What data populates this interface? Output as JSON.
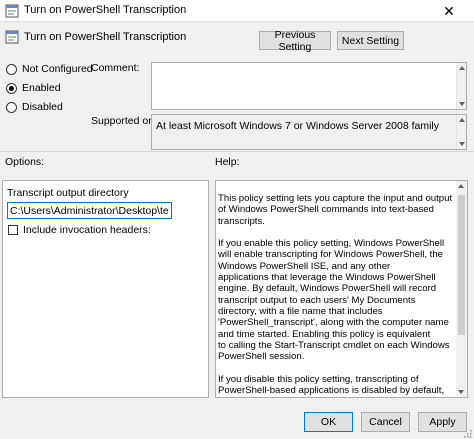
{
  "window": {
    "title": "Turn on PowerShell Transcription",
    "close_symbol": "✕"
  },
  "header": {
    "title": "Turn on PowerShell Transcription",
    "prev_label": "Previous Setting",
    "next_label": "Next Setting"
  },
  "state": {
    "options": [
      "Not Configured",
      "Enabled",
      "Disabled"
    ],
    "selected": "Enabled"
  },
  "comment": {
    "label": "Comment:",
    "value": ""
  },
  "supported": {
    "label": "Supported on:",
    "value": "At least Microsoft Windows 7 or Windows Server 2008 family"
  },
  "options_panel": {
    "label": "Options:",
    "transcript_label": "Transcript output directory",
    "transcript_value": "C:\\Users\\Administrator\\Desktop\\test",
    "invocation_label": "Include invocation headers:",
    "invocation_checked": false
  },
  "help_panel": {
    "label": "Help:",
    "paragraphs": [
      "        This policy setting lets you capture the input and output of Windows PowerShell commands into text-based transcripts.",
      "        If you enable this policy setting, Windows PowerShell will enable transcripting for Windows PowerShell, the Windows PowerShell ISE, and any other\n        applications that leverage the Windows PowerShell engine. By default, Windows PowerShell will record transcript output to each users' My Documents\n        directory, with a file name that includes 'PowerShell_transcript', along with the computer name and time started. Enabling this policy is equivalent\n        to calling the Start-Transcript cmdlet on each Windows PowerShell session.",
      "        If you disable this policy setting, transcripting of PowerShell-based applications is disabled by default, although transcripting can still be enabled\n        through the Start-Transcript cmdlet."
    ]
  },
  "footer": {
    "ok_label": "OK",
    "cancel_label": "Cancel",
    "apply_label": "Apply"
  },
  "colors": {
    "background": "#f0f0f0",
    "accent": "#0078d7",
    "button": "#e1e1e1"
  },
  "icons": {
    "title": "policy-setting-icon",
    "header": "policy-setting-icon",
    "close": "close-icon"
  }
}
